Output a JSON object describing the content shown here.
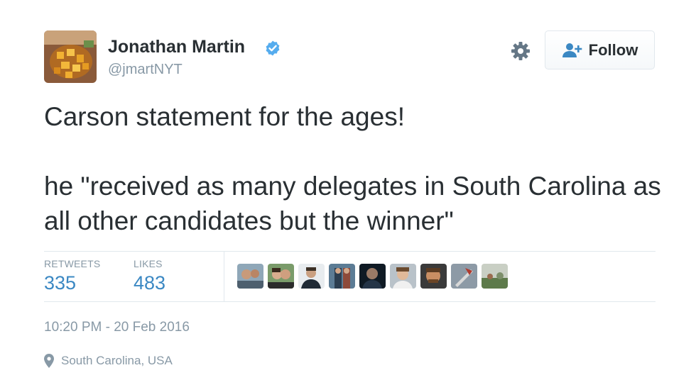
{
  "author": {
    "name": "Jonathan Martin",
    "handle": "@jmartNYT"
  },
  "icons": {
    "avatar": "avatar-food-photo",
    "verified": "verified-badge-icon",
    "gear": "gear-icon",
    "follow": "add-user-icon",
    "location": "location-pin-icon"
  },
  "actions": {
    "follow_label": "Follow"
  },
  "tweet": {
    "line1": "Carson statement for the ages!",
    "line2": "he \"received as many delegates in South Carolina as all other candidates but the winner\""
  },
  "stats": {
    "retweets_label": "RETWEETS",
    "retweets_count": "335",
    "likes_label": "LIKES",
    "likes_count": "483"
  },
  "meta": {
    "timestamp": "10:20 PM - 20 Feb 2016",
    "location": "South Carolina, USA"
  },
  "colors": {
    "text": "#292f33",
    "secondary": "#8899a6",
    "accent": "#3b88c3",
    "verified": "#55acee",
    "border": "#e1e8ed"
  }
}
